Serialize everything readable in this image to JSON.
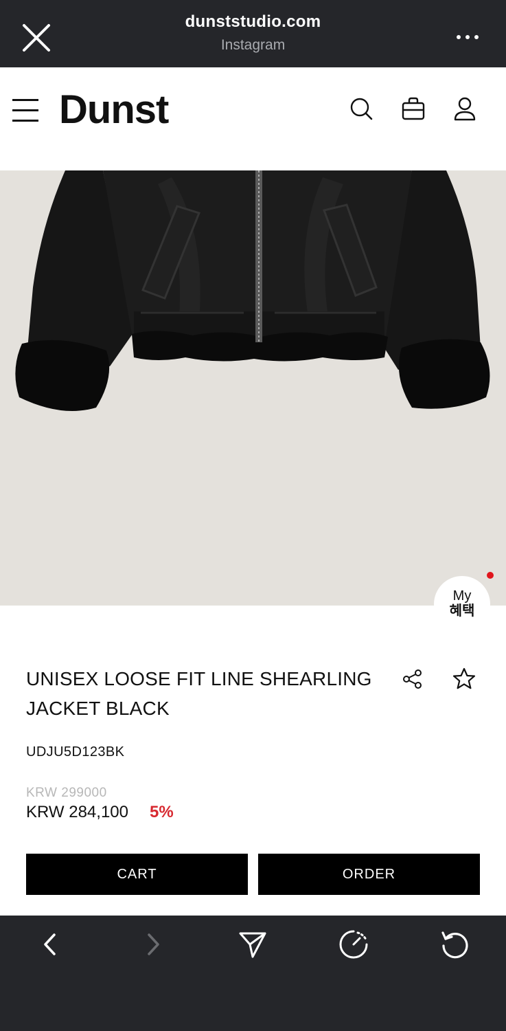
{
  "browser": {
    "url": "dunststudio.com",
    "source": "Instagram"
  },
  "site": {
    "logo": "Dunst"
  },
  "benefits": {
    "line1": "My",
    "line2": "혜택"
  },
  "product": {
    "title": "UNISEX LOOSE FIT LINE SHEARLING JACKET BLACK",
    "code": "UDJU5D123BK",
    "price_original": "KRW 299000",
    "price_sale": "KRW 284,100",
    "discount": "5%"
  },
  "actions": {
    "cart_label": "CART",
    "order_label": "ORDER"
  },
  "icons": {
    "browser": [
      "close-icon",
      "more-icon"
    ],
    "header": [
      "menu-icon",
      "search-icon",
      "bag-icon",
      "user-icon"
    ],
    "product": [
      "share-icon",
      "star-icon"
    ],
    "toolbar": [
      "back-icon",
      "forward-icon",
      "send-icon",
      "speed-icon",
      "refresh-icon"
    ]
  },
  "colors": {
    "browser_chrome": "#25262a",
    "image_background": "#e4e1dc",
    "discount": "#d7282f",
    "notification_dot": "#e0151c",
    "button": "#000000"
  }
}
